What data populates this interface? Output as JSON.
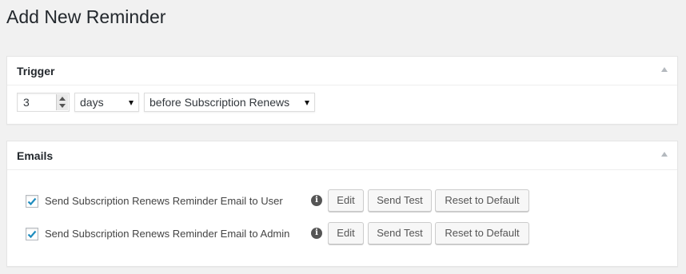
{
  "page": {
    "title": "Add New Reminder"
  },
  "trigger": {
    "title": "Trigger",
    "amount": "3",
    "unit": "days",
    "timing": "before Subscription Renews"
  },
  "emails": {
    "title": "Emails",
    "rows": [
      {
        "checked": true,
        "label": "Send Subscription Renews Reminder Email to User",
        "edit": "Edit",
        "send_test": "Send Test",
        "reset": "Reset to Default"
      },
      {
        "checked": true,
        "label": "Send Subscription Renews Reminder Email to Admin",
        "edit": "Edit",
        "send_test": "Send Test",
        "reset": "Reset to Default"
      }
    ]
  },
  "colors": {
    "background": "#f1f1f1",
    "checkmark": "#1e8cbe",
    "panel": "#ffffff"
  },
  "icons": [
    "collapse-arrow-icon",
    "spinner-up-icon",
    "spinner-down-icon",
    "dropdown-caret-icon",
    "checkmark-icon",
    "info-icon"
  ]
}
